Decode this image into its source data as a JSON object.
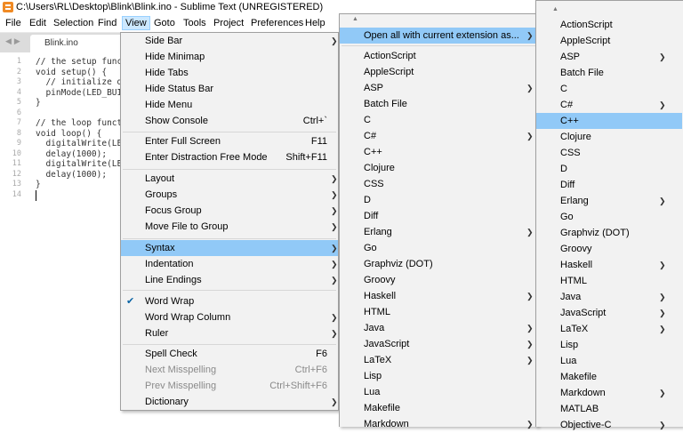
{
  "window": {
    "title": "C:\\Users\\RL\\Desktop\\Blink\\Blink.ino - Sublime Text (UNREGISTERED)"
  },
  "menubar": [
    {
      "label": "File",
      "active": false
    },
    {
      "label": "Edit",
      "active": false
    },
    {
      "label": "Selection",
      "active": false
    },
    {
      "label": "Find",
      "active": false
    },
    {
      "label": "View",
      "active": true
    },
    {
      "label": "Goto",
      "active": false
    },
    {
      "label": "Tools",
      "active": false
    },
    {
      "label": "Project",
      "active": false
    },
    {
      "label": "Preferences",
      "active": false
    },
    {
      "label": "Help",
      "active": false
    }
  ],
  "tab": {
    "label": "Blink.ino"
  },
  "editor": {
    "line_numbers": [
      "1",
      "2",
      "3",
      "4",
      "5",
      "6",
      "7",
      "8",
      "9",
      "10",
      "11",
      "12",
      "13",
      "14"
    ],
    "lines": [
      "// the setup function runs once when you press reset or power the board",
      "void setup() {",
      "  // initialize digital pin LED_BUILTIN as an output.",
      "  pinMode(LED_BUILTIN, OUTPUT);",
      "}",
      "",
      "// the loop function runs over and over again forever",
      "void loop() {",
      "  digitalWrite(LED_BUILTIN, HIGH);",
      "  delay(1000);",
      "  digitalWrite(LED_BUILTIN, LOW);",
      "  delay(1000);",
      "}",
      ""
    ]
  },
  "view_menu": [
    {
      "label": "Side Bar",
      "shortcut": "",
      "submenu": true
    },
    {
      "label": "Hide Minimap",
      "shortcut": "",
      "submenu": false
    },
    {
      "label": "Hide Tabs",
      "shortcut": "",
      "submenu": false
    },
    {
      "label": "Hide Status Bar",
      "shortcut": "",
      "submenu": false
    },
    {
      "label": "Hide Menu",
      "shortcut": "",
      "submenu": false
    },
    {
      "label": "Show Console",
      "shortcut": "Ctrl+`",
      "submenu": false
    },
    {
      "label": "Enter Full Screen",
      "shortcut": "F11",
      "submenu": false
    },
    {
      "label": "Enter Distraction Free Mode",
      "shortcut": "Shift+F11",
      "submenu": false
    },
    {
      "label": "Layout",
      "shortcut": "",
      "submenu": true
    },
    {
      "label": "Groups",
      "shortcut": "",
      "submenu": true
    },
    {
      "label": "Focus Group",
      "shortcut": "",
      "submenu": true
    },
    {
      "label": "Move File to Group",
      "shortcut": "",
      "submenu": true
    },
    {
      "label": "Syntax",
      "shortcut": "",
      "submenu": true,
      "highlighted": true
    },
    {
      "label": "Indentation",
      "shortcut": "",
      "submenu": true
    },
    {
      "label": "Line Endings",
      "shortcut": "",
      "submenu": true
    },
    {
      "label": "Word Wrap",
      "shortcut": "",
      "submenu": false,
      "checked": true
    },
    {
      "label": "Word Wrap Column",
      "shortcut": "",
      "submenu": true
    },
    {
      "label": "Ruler",
      "shortcut": "",
      "submenu": true
    },
    {
      "label": "Spell Check",
      "shortcut": "F6",
      "submenu": false
    },
    {
      "label": "Next Misspelling",
      "shortcut": "Ctrl+F6",
      "submenu": false,
      "disabled": true
    },
    {
      "label": "Prev Misspelling",
      "shortcut": "Ctrl+Shift+F6",
      "submenu": false,
      "disabled": true
    },
    {
      "label": "Dictionary",
      "shortcut": "",
      "submenu": true
    }
  ],
  "syntax_menu": [
    {
      "label": "Open all with current extension as...",
      "submenu": true,
      "highlighted": true
    },
    {
      "label": "ActionScript",
      "submenu": false
    },
    {
      "label": "AppleScript",
      "submenu": false
    },
    {
      "label": "ASP",
      "submenu": true
    },
    {
      "label": "Batch File",
      "submenu": false
    },
    {
      "label": "C",
      "submenu": false
    },
    {
      "label": "C#",
      "submenu": true
    },
    {
      "label": "C++",
      "submenu": false
    },
    {
      "label": "Clojure",
      "submenu": false
    },
    {
      "label": "CSS",
      "submenu": false
    },
    {
      "label": "D",
      "submenu": false
    },
    {
      "label": "Diff",
      "submenu": false
    },
    {
      "label": "Erlang",
      "submenu": true
    },
    {
      "label": "Go",
      "submenu": false
    },
    {
      "label": "Graphviz (DOT)",
      "submenu": false
    },
    {
      "label": "Groovy",
      "submenu": false
    },
    {
      "label": "Haskell",
      "submenu": true
    },
    {
      "label": "HTML",
      "submenu": false
    },
    {
      "label": "Java",
      "submenu": true
    },
    {
      "label": "JavaScript",
      "submenu": true
    },
    {
      "label": "LaTeX",
      "submenu": true
    },
    {
      "label": "Lisp",
      "submenu": false
    },
    {
      "label": "Lua",
      "submenu": false
    },
    {
      "label": "Makefile",
      "submenu": false
    },
    {
      "label": "Markdown",
      "submenu": true
    }
  ],
  "extension_menu": [
    {
      "label": "ActionScript",
      "submenu": false
    },
    {
      "label": "AppleScript",
      "submenu": false
    },
    {
      "label": "ASP",
      "submenu": true
    },
    {
      "label": "Batch File",
      "submenu": false
    },
    {
      "label": "C",
      "submenu": false
    },
    {
      "label": "C#",
      "submenu": true
    },
    {
      "label": "C++",
      "submenu": false,
      "highlighted": true
    },
    {
      "label": "Clojure",
      "submenu": false
    },
    {
      "label": "CSS",
      "submenu": false
    },
    {
      "label": "D",
      "submenu": false
    },
    {
      "label": "Diff",
      "submenu": false
    },
    {
      "label": "Erlang",
      "submenu": true
    },
    {
      "label": "Go",
      "submenu": false
    },
    {
      "label": "Graphviz (DOT)",
      "submenu": false
    },
    {
      "label": "Groovy",
      "submenu": false
    },
    {
      "label": "Haskell",
      "submenu": true
    },
    {
      "label": "HTML",
      "submenu": false
    },
    {
      "label": "Java",
      "submenu": true
    },
    {
      "label": "JavaScript",
      "submenu": true
    },
    {
      "label": "LaTeX",
      "submenu": true
    },
    {
      "label": "Lisp",
      "submenu": false
    },
    {
      "label": "Lua",
      "submenu": false
    },
    {
      "label": "Makefile",
      "submenu": false
    },
    {
      "label": "Markdown",
      "submenu": true
    },
    {
      "label": "MATLAB",
      "submenu": false
    },
    {
      "label": "Objective-C",
      "submenu": true
    }
  ],
  "icons": {
    "app": "sublime-logo-icon",
    "submenu": "chevron-right-icon",
    "check": "check-icon",
    "scroll": "scroll-up-icon"
  },
  "colors": {
    "highlight": "#91c9f7",
    "active_menubar": "#cce8ff",
    "menu_bg": "#f2f2f2"
  }
}
